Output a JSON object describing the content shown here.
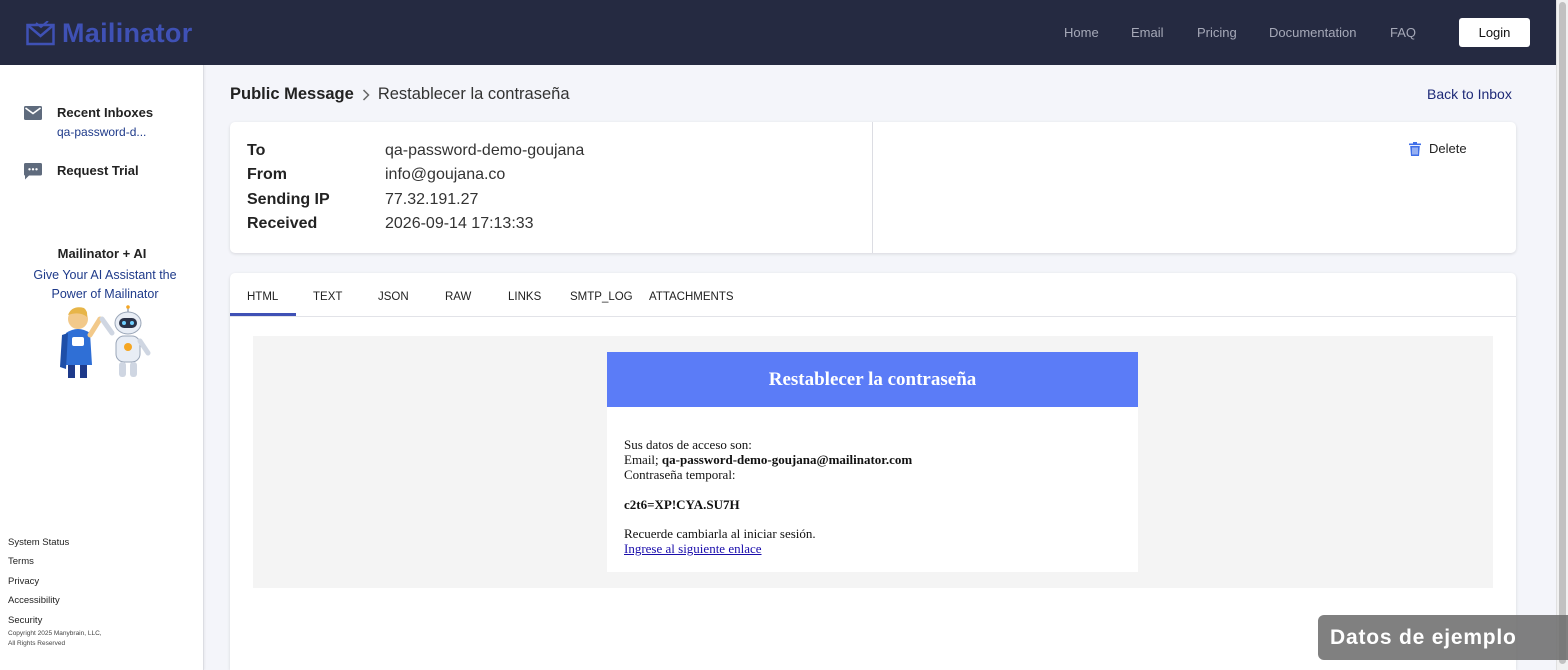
{
  "app": {
    "logo_text": "Mailinator"
  },
  "nav": {
    "items": [
      "Home",
      "Email",
      "Pricing",
      "Documentation",
      "FAQ"
    ],
    "login_label": "Login"
  },
  "sidebar": {
    "recent_inboxes_label": "Recent Inboxes",
    "recent_inbox_item": "qa-password-d...",
    "request_trial_label": "Request Trial",
    "ai_title": "Mailinator + AI",
    "ai_description": "Give Your AI Assistant the Power of Mailinator",
    "footer_links": [
      "System Status",
      "Terms",
      "Privacy",
      "Accessibility",
      "Security"
    ],
    "copyright_line1": "Copyright 2025 Manybrain, LLC,",
    "copyright_line2": "All Rights Reserved"
  },
  "breadcrumb": {
    "root": "Public Message",
    "current": "Restablecer la contraseña"
  },
  "back_to_inbox_label": "Back to Inbox",
  "message": {
    "fields": [
      {
        "label": "To",
        "value": "qa-password-demo-goujana"
      },
      {
        "label": "From",
        "value": "info@goujana.co"
      },
      {
        "label": "Sending IP",
        "value": "77.32.191.27"
      },
      {
        "label": "Received",
        "value": "2026-09-14 17:13:33"
      }
    ],
    "delete_label": "Delete"
  },
  "tabs": {
    "items": [
      "HTML",
      "TEXT",
      "JSON",
      "RAW",
      "LINKS",
      "SMTP_LOG",
      "ATTACHMENTS"
    ],
    "active": "HTML"
  },
  "email_content": {
    "header_title": "Restablecer la contraseña",
    "line1": "Sus datos de acceso son:",
    "email_prefix": "Email; ",
    "email_value": "qa-password-demo-goujana@mailinator.com",
    "temp_password_label": "Contraseña temporal:",
    "temp_password_value": "c2t6=XP!CYA.SU7H",
    "reminder": "Recuerde cambiarla al iniciar sesión.",
    "link_text": "Ingrese al siguiente enlace"
  },
  "watermark_text": "Datos de ejemplo",
  "colors": {
    "topbar": "#252a41",
    "brand": "#3f51b5",
    "email_header": "#5b7cf7"
  }
}
